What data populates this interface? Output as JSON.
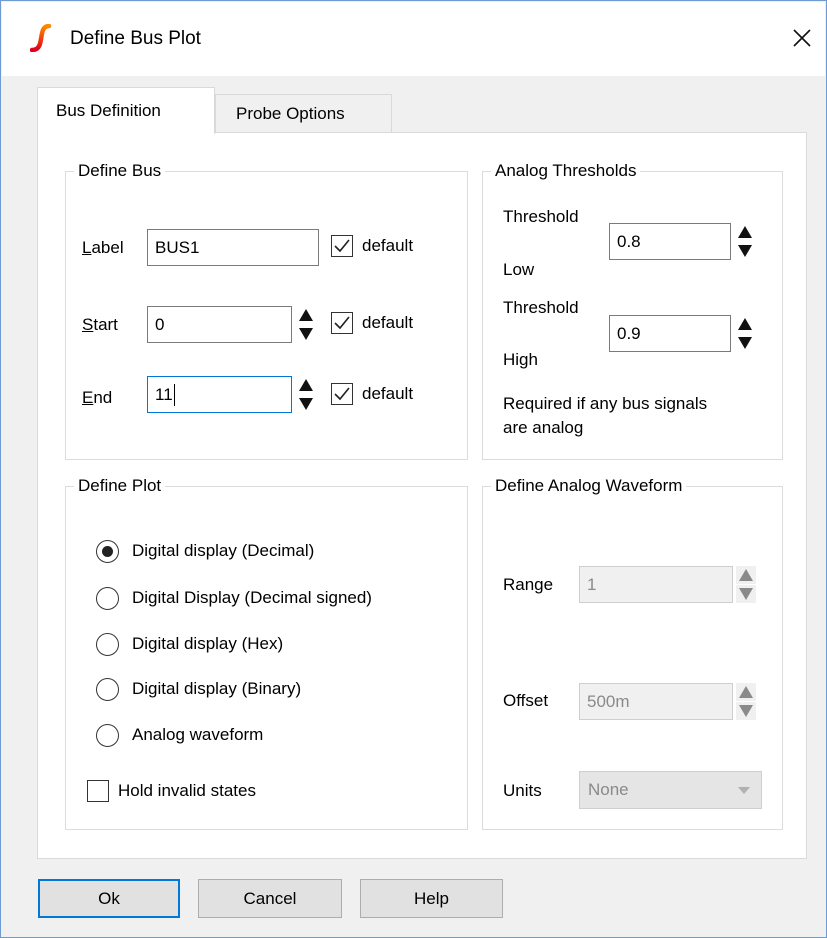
{
  "window": {
    "title": "Define Bus Plot"
  },
  "tabs": [
    {
      "label": "Bus Definition",
      "active": true
    },
    {
      "label": "Probe Options",
      "active": false
    }
  ],
  "define_bus": {
    "legend": "Define Bus",
    "label": {
      "text": "Label",
      "value": "BUS1",
      "default_label": "default",
      "default_checked": true
    },
    "start": {
      "text": "Start",
      "value": "0",
      "default_label": "default",
      "default_checked": true
    },
    "end": {
      "text": "End",
      "value": "11",
      "default_label": "default",
      "default_checked": true
    }
  },
  "analog_thresholds": {
    "legend": "Analog Thresholds",
    "low": {
      "label_top": "Threshold",
      "label_bottom": "Low",
      "value": "0.8"
    },
    "high": {
      "label_top": "Threshold",
      "label_bottom": "High",
      "value": "0.9"
    },
    "note_line1": "Required if any bus signals",
    "note_line2": "are analog"
  },
  "define_plot": {
    "legend": "Define Plot",
    "options": [
      {
        "label": "Digital display (Decimal)",
        "checked": true
      },
      {
        "label": "Digital Display (Decimal signed)",
        "checked": false
      },
      {
        "label": "Digital display (Hex)",
        "checked": false
      },
      {
        "label": "Digital display (Binary)",
        "checked": false
      },
      {
        "label": "Analog waveform",
        "checked": false
      }
    ],
    "hold_invalid": {
      "label": "Hold invalid states",
      "checked": false
    }
  },
  "analog_waveform": {
    "legend": "Define Analog Waveform",
    "range": {
      "label": "Range",
      "value": "1"
    },
    "offset": {
      "label": "Offset",
      "value": "500m"
    },
    "units": {
      "label": "Units",
      "value": "None"
    }
  },
  "buttons": {
    "ok": "Ok",
    "cancel": "Cancel",
    "help": "Help"
  },
  "colors": {
    "accent": "#0078d7",
    "icon": "#e8271a"
  }
}
